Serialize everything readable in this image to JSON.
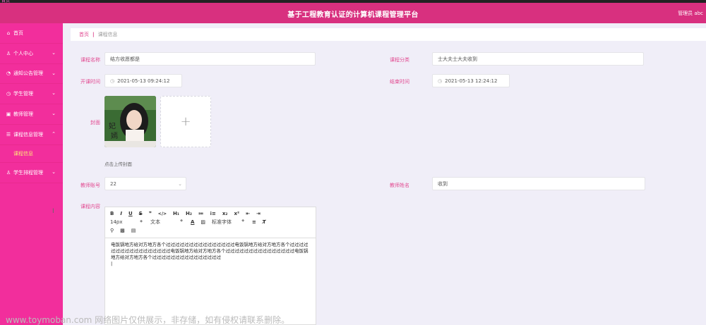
{
  "topbar": {
    "fragment": "首页"
  },
  "header": {
    "title": "基于工程教育认证的计算机课程管理平台",
    "admin_text": "管理员 abc"
  },
  "sidebar": {
    "items": [
      {
        "icon": "home-icon",
        "glyph": "⌂",
        "label": "首页",
        "has_children": false
      },
      {
        "icon": "user-icon",
        "glyph": "♙",
        "label": "个人中心",
        "has_children": true
      },
      {
        "icon": "notice-icon",
        "glyph": "◔",
        "label": "通知公告管理",
        "has_children": true
      },
      {
        "icon": "student-icon",
        "glyph": "◷",
        "label": "学生管理",
        "has_children": true
      },
      {
        "icon": "teacher-icon",
        "glyph": "▣",
        "label": "教师管理",
        "has_children": true
      },
      {
        "icon": "course-icon",
        "glyph": "☰",
        "label": "课程信息管理",
        "has_children": true,
        "expanded": true,
        "children": [
          "课程信息"
        ]
      },
      {
        "icon": "schedule-icon",
        "glyph": "♙",
        "label": "学生排程管理",
        "has_children": true
      }
    ]
  },
  "breadcrumb": {
    "home": "首页",
    "separator": "|",
    "current": "课程信息"
  },
  "form": {
    "course_name": {
      "label": "课程名称",
      "value": "结方收愿都是"
    },
    "course_category": {
      "label": "课程分类",
      "value": "士大夫士大夫收到"
    },
    "start_time": {
      "label": "开课时间",
      "value": "2021-05-13 09:24:12"
    },
    "end_time": {
      "label": "结束时间",
      "value": "2021-05-13 12:24:12"
    },
    "cover": {
      "label": "封面",
      "upload_tip": "点击上传封面",
      "plus": "+"
    },
    "teacher_account": {
      "label": "教师账号",
      "value": "22"
    },
    "teacher_name": {
      "label": "教师姓名",
      "value": "收到"
    },
    "course_content": {
      "label": "课程内容",
      "toolbar_row1": [
        "B",
        "I",
        "U",
        "S",
        "❞",
        "</>",
        "H₁",
        "H₂",
        "≔",
        "⁝≡",
        "x₂",
        "x²",
        "⇤",
        "⇥"
      ],
      "font_size": "14px",
      "text_style": "文本",
      "font_family": "标准字体",
      "text": "电饭锅地方给对方地方各个过过过过过过过过过过过过过过过电饭锅地方给对方地方各个过过过过过过过过过过过过过过过过过电饭锅地方给对方地方各个过过过过过过过过过过过过过过过电饭锅地方给对方地方各个过过过过过过过过过过过过过过过"
    }
  },
  "watermark": "www.toymoban.com 网络图片仅供展示，非存储，如有侵权请联系删除。",
  "colors": {
    "header": "#d8307f",
    "sidebar": "#f22e9c",
    "label": "#e24a91",
    "active_sub": "#ffe37a"
  }
}
